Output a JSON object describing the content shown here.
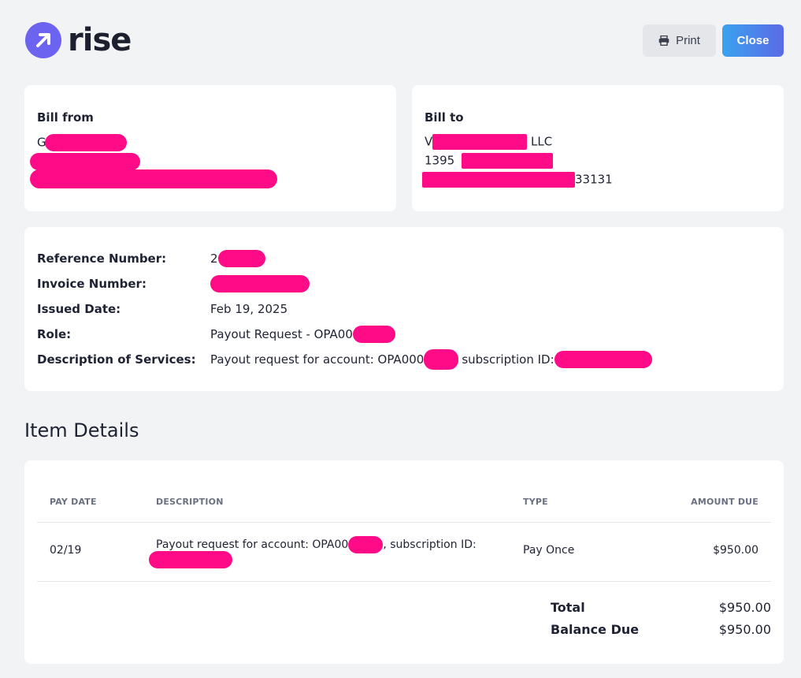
{
  "header": {
    "brand": "rise",
    "print_label": "Print",
    "close_label": "Close"
  },
  "bill_from": {
    "label": "Bill from",
    "line1_prefix": "G"
  },
  "bill_to": {
    "label": "Bill to",
    "line1_prefix": "V",
    "line1_suffix": "LLC",
    "line2_prefix": "1395",
    "line3_suffix": "33131"
  },
  "reference": {
    "rows": [
      {
        "key": "Reference Number:",
        "value": "2"
      },
      {
        "key": "Invoice Number:",
        "value": ""
      },
      {
        "key": "Issued Date:",
        "value": "Feb 19, 2025"
      },
      {
        "key": "Role:",
        "value": "Payout Request - OPA00"
      },
      {
        "key": "Description of Services:",
        "value": "Payout request for account: OPA000",
        "value2": "subscription ID:"
      }
    ]
  },
  "items": {
    "title": "Item Details",
    "columns": [
      "PAY DATE",
      "DESCRIPTION",
      "TYPE",
      "AMOUNT DUE"
    ],
    "row": {
      "pay_date": "02/19",
      "description_a": "Payout request for account: OPA00",
      "description_b": ", subscription ID:",
      "type": "Pay Once",
      "amount": "$950.00"
    },
    "total_label": "Total",
    "total_value": "$950.00",
    "balance_label": "Balance Due",
    "balance_value": "$950.00"
  },
  "colors": {
    "accent_gradient_start": "#3aa2f0",
    "accent_gradient_end": "#5b6ae6",
    "brand": "#6c63f0",
    "redaction": "#ff0a87"
  },
  "icons": [
    "rise-logo-icon",
    "printer-icon"
  ]
}
